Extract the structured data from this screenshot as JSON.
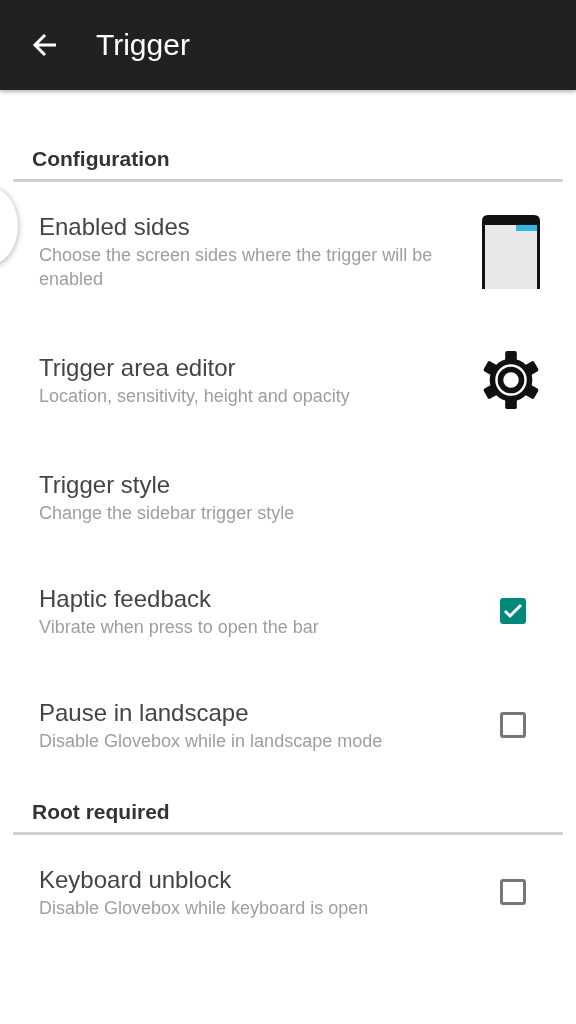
{
  "app_bar": {
    "title": "Trigger"
  },
  "sections": [
    {
      "header": "Configuration",
      "items": [
        {
          "kind": "phone",
          "title": "Enabled sides",
          "subtitle": "Choose the screen sides where the trigger will be enabled"
        },
        {
          "kind": "gear",
          "title": "Trigger area editor",
          "subtitle": "Location, sensitivity, height and opacity"
        },
        {
          "kind": "plain",
          "title": "Trigger style",
          "subtitle": "Change the sidebar trigger style"
        },
        {
          "kind": "checkbox",
          "title": "Haptic feedback",
          "subtitle": "Vibrate when press to open the bar",
          "checked": true
        },
        {
          "kind": "checkbox",
          "title": "Pause in landscape",
          "subtitle": "Disable Glovebox while in landscape mode",
          "checked": false
        }
      ]
    },
    {
      "header": "Root required",
      "items": [
        {
          "kind": "checkbox",
          "title": "Keyboard unblock",
          "subtitle": "Disable Glovebox while keyboard is open",
          "checked": false
        }
      ]
    }
  ]
}
